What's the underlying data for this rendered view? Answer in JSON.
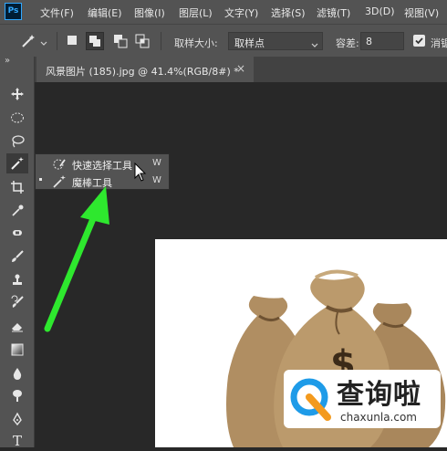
{
  "app": {
    "logo_text": "Ps"
  },
  "menu": [
    "文件(F)",
    "编辑(E)",
    "图像(I)",
    "图层(L)",
    "文字(Y)",
    "选择(S)",
    "滤镜(T)",
    "3D(D)",
    "视图(V)"
  ],
  "options_bar": {
    "sample_size_label": "取样大小:",
    "sample_size_value": "取样点",
    "tolerance_label": "容差:",
    "tolerance_value": "8",
    "antialias_label": "消锯"
  },
  "document_tab": {
    "title": "风景图片 (185).jpg @ 41.4%(RGB/8#) *",
    "close": "×"
  },
  "tool_flyout": {
    "items": [
      {
        "label": "快速选择工具",
        "shortcut": "W"
      },
      {
        "label": "魔棒工具",
        "shortcut": "W"
      }
    ]
  },
  "toolbar": {
    "text_tool_glyph": "T",
    "collapse_glyph": "»"
  },
  "watermark": {
    "title": "查询啦",
    "url": "chaxunla.com"
  },
  "colors": {
    "pointer_arrow": "#2ee82e",
    "accent": "#31a8ff",
    "panel": "#535353",
    "workspace": "#282828"
  }
}
